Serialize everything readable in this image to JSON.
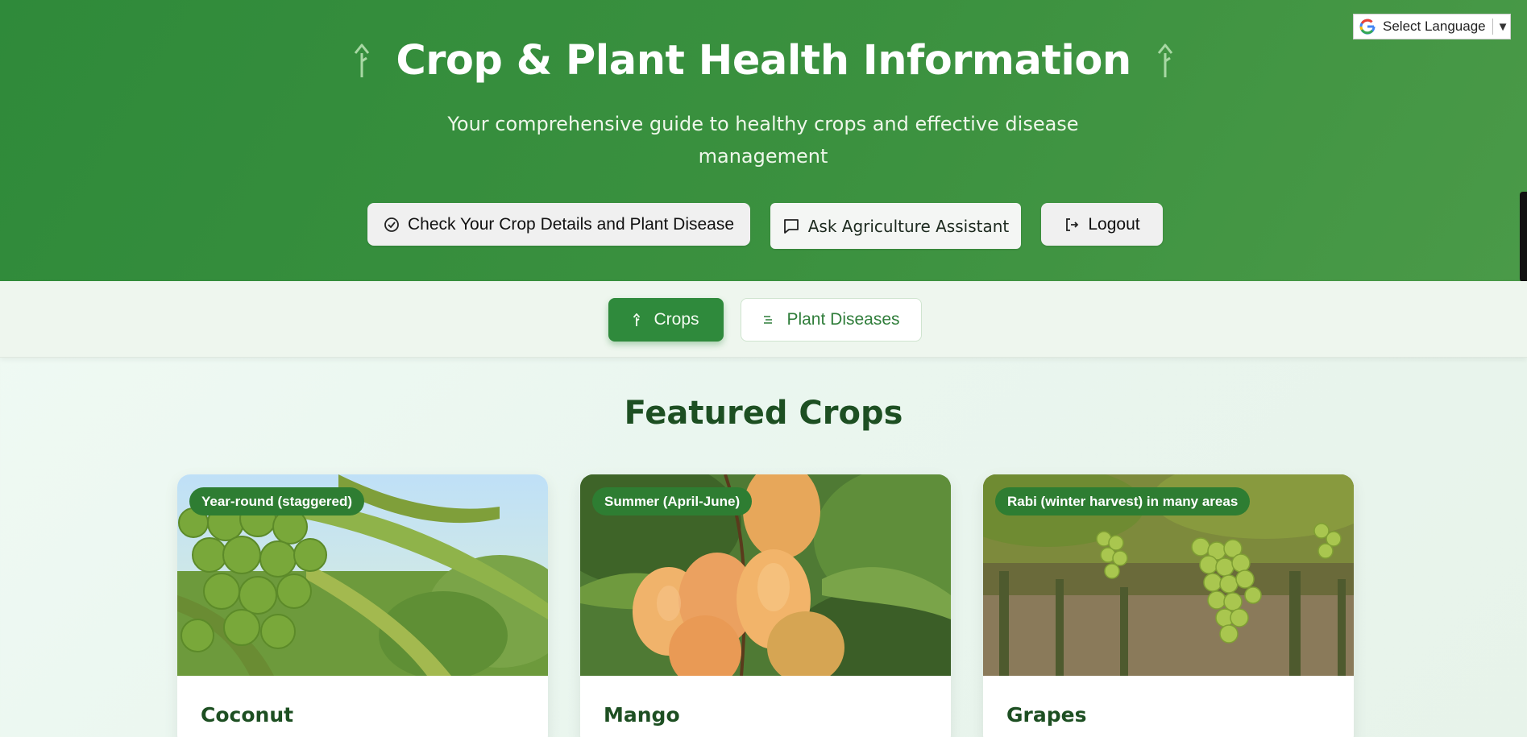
{
  "header": {
    "title": "Crop & Plant Health Information",
    "subtitle": "Your comprehensive guide to healthy crops and effective disease management",
    "buttons": {
      "check": "Check Your Crop Details and Plant Disease",
      "assistant": "Ask Agriculture Assistant",
      "logout": "Logout"
    },
    "language_selector": "Select Language",
    "language_arrow": "▼"
  },
  "tabs": {
    "crops": "Crops",
    "diseases": "Plant Diseases"
  },
  "section": {
    "title": "Featured Crops"
  },
  "cards": [
    {
      "name": "Coconut",
      "season": "Year-round (staggered)"
    },
    {
      "name": "Mango",
      "season": "Summer (April-June)"
    },
    {
      "name": "Grapes",
      "season": "Rabi (winter harvest) in many areas"
    }
  ],
  "colors": {
    "primary_green": "#2f8a3a",
    "dark_green_text": "#1d4f22",
    "badge_green": "#2e7d32"
  },
  "icons": [
    "sprout-icon",
    "check-circle-icon",
    "chat-icon",
    "logout-icon",
    "google-icon",
    "list-icon"
  ]
}
